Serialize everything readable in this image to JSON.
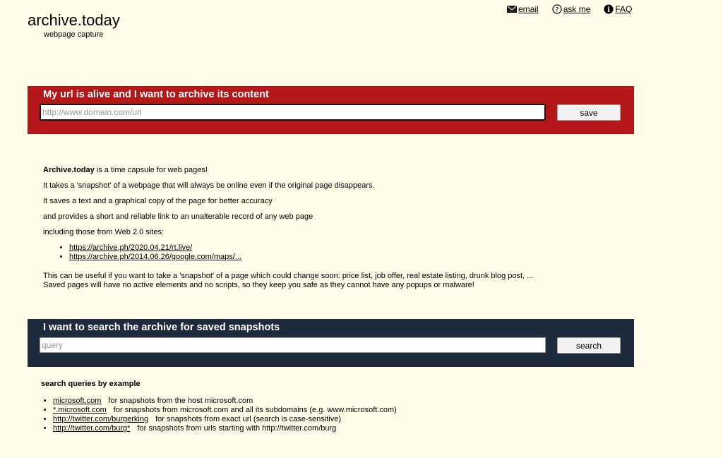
{
  "logo": {
    "title": "archive.today",
    "subtitle": "webpage capture"
  },
  "toplinks": {
    "email": "email",
    "ask": "ask me",
    "faq": "FAQ"
  },
  "archive_form": {
    "title": "My url is alive and I want to archive its content",
    "placeholder": "http://www.domain.com/url",
    "button": "save"
  },
  "description": {
    "brand": "Archive.today",
    "line1_rest": " is a time capsule for web pages!",
    "line2": "It takes a 'snapshot' of a webpage that will always be online even if the original page disappears.",
    "line3": "It saves a text and a graphical copy of the page for better accuracy",
    "line4": "and provides a short and reliable link to an unalterable record of any web page",
    "line5": "including those from Web 2.0 sites:",
    "links": [
      "https://archive.ph/2020.04.21/rt.live/",
      "https://archive.ph/2014.06.26/google.com/maps/..."
    ],
    "note1": "This can be useful if you want to take a 'snapshot' of a page which could change soon: price list, job offer, real estate listing, drunk blog post, ...",
    "note2": "Saved pages will have no active elements and no scripts, so they keep you safe as they cannot have any popups or malware!"
  },
  "search_form": {
    "title": "I want to search the archive for saved snapshots",
    "placeholder": "query",
    "button": "search"
  },
  "examples": {
    "title": "search queries by example",
    "items": [
      {
        "link": "microsoft.com",
        "desc": "for snapshots from the host microsoft.com"
      },
      {
        "link": "*.microsoft.com",
        "desc": "for snapshots from microsoft.com and all its subdomains (e.g. www.microsoft.com)"
      },
      {
        "link": "http://twitter.com/burgerking",
        "desc": "for snapshots from exact url (search is case-sensitive)"
      },
      {
        "link": "http://twitter.com/burg*",
        "desc": "for snapshots from urls starting with http://twitter.com/burg"
      }
    ]
  }
}
